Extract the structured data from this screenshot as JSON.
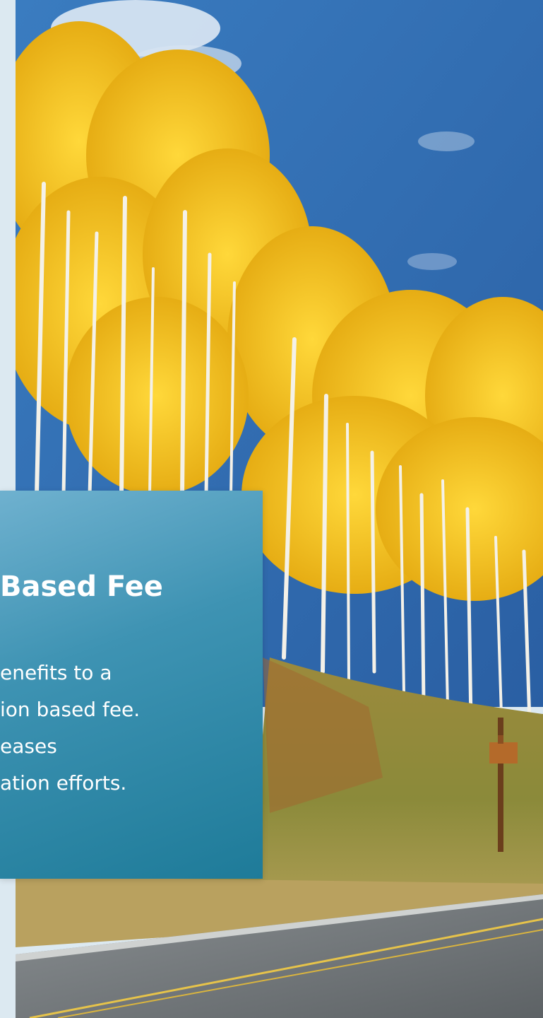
{
  "card": {
    "title": "Based Fee",
    "lines": [
      "enefits to a",
      "ion based fee.",
      "eases",
      "ation efforts."
    ]
  },
  "colors": {
    "sky": "#2f6bb0",
    "foliage": "#f2c21b",
    "card_top": "#6fb1cf",
    "card_bottom": "#1e7b99",
    "road": "#6f7476",
    "strip": "#dce9f1"
  }
}
